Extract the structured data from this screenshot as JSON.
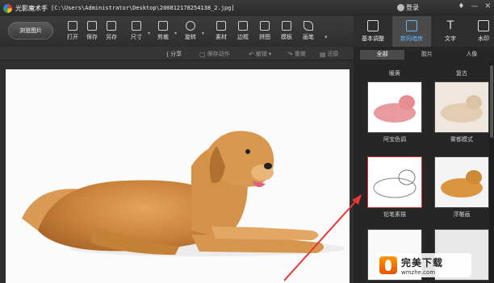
{
  "titlebar": {
    "app_name": "光影魔术手",
    "file_path": "[C:\\Users\\Administrator\\Desktop\\200812178254138_2.jpg]",
    "login": "登录",
    "controls": [
      "♦",
      "—",
      "✕"
    ]
  },
  "toolbar": {
    "browse_label": "浏览图片",
    "tools": [
      {
        "name": "open",
        "label": "打开"
      },
      {
        "name": "save",
        "label": "保存"
      },
      {
        "name": "save-as",
        "label": "另存"
      },
      {
        "name": "size",
        "label": "尺寸"
      },
      {
        "name": "crop",
        "label": "剪裁"
      },
      {
        "name": "rotate",
        "label": "旋转"
      },
      {
        "name": "material",
        "label": "素材"
      },
      {
        "name": "border",
        "label": "边框"
      },
      {
        "name": "collage",
        "label": "拼图"
      },
      {
        "name": "template",
        "label": "模板"
      },
      {
        "name": "brush",
        "label": "画笔"
      }
    ],
    "more": "▾"
  },
  "right_tabs": [
    {
      "name": "basic",
      "label": "基本调整",
      "active": false
    },
    {
      "name": "digital-darkroom",
      "label": "数码暗房",
      "active": true
    },
    {
      "name": "text",
      "label": "文字",
      "active": false
    },
    {
      "name": "watermark",
      "label": "水印",
      "active": false
    }
  ],
  "subbar": {
    "share": "分享",
    "save_action": "保存动作",
    "undo": "撤销",
    "redo": "重做",
    "restore": "还原"
  },
  "panel": {
    "tabs": [
      "全部",
      "胶片",
      "人像"
    ],
    "active_tab": 0,
    "top_labels": [
      "暖黄",
      "复古"
    ],
    "effects": [
      {
        "label": "阿宝色调",
        "selected": false
      },
      {
        "label": "雾都模式",
        "selected": false
      },
      {
        "label": "铅笔素描",
        "selected": true
      },
      {
        "label": "浮雕画",
        "selected": false
      }
    ]
  },
  "watermark": {
    "brand": "完美下载",
    "url": "wmzhe.com"
  },
  "colors": {
    "accent": "#5db8ff",
    "selection": "#d33333",
    "arrow": "#e53935"
  }
}
